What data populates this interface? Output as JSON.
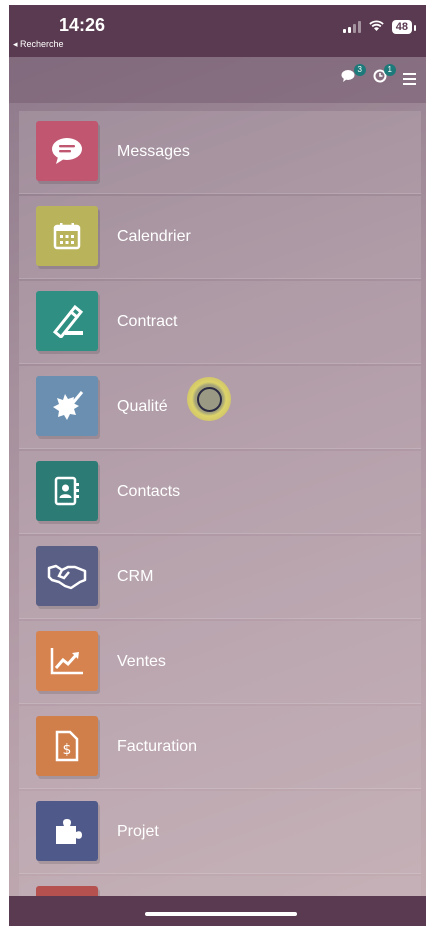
{
  "status_bar": {
    "time": "14:26",
    "back_label": "◂ Recherche",
    "battery": "48"
  },
  "nav": {
    "messages_badge": "3",
    "activity_badge": "1"
  },
  "apps": [
    {
      "label": "Messages",
      "icon": "chat-bubble-icon",
      "color": "#c0566f"
    },
    {
      "label": "Calendrier",
      "icon": "calendar-icon",
      "color": "#b9b35c"
    },
    {
      "label": "Contract",
      "icon": "pen-sign-icon",
      "color": "#2e8f82"
    },
    {
      "label": "Qualité",
      "icon": "quality-badge-icon",
      "color": "#6a8fb0"
    },
    {
      "label": "Contacts",
      "icon": "address-book-icon",
      "color": "#2d7b75"
    },
    {
      "label": "CRM",
      "icon": "handshake-icon",
      "color": "#5a5f85"
    },
    {
      "label": "Ventes",
      "icon": "trend-chart-icon",
      "color": "#d7834f"
    },
    {
      "label": "Facturation",
      "icon": "invoice-icon",
      "color": "#d07e4a"
    },
    {
      "label": "Projet",
      "icon": "puzzle-icon",
      "color": "#4f5a8a"
    },
    {
      "label": "",
      "icon": "partial-app-icon",
      "color": "#b5524f"
    }
  ]
}
